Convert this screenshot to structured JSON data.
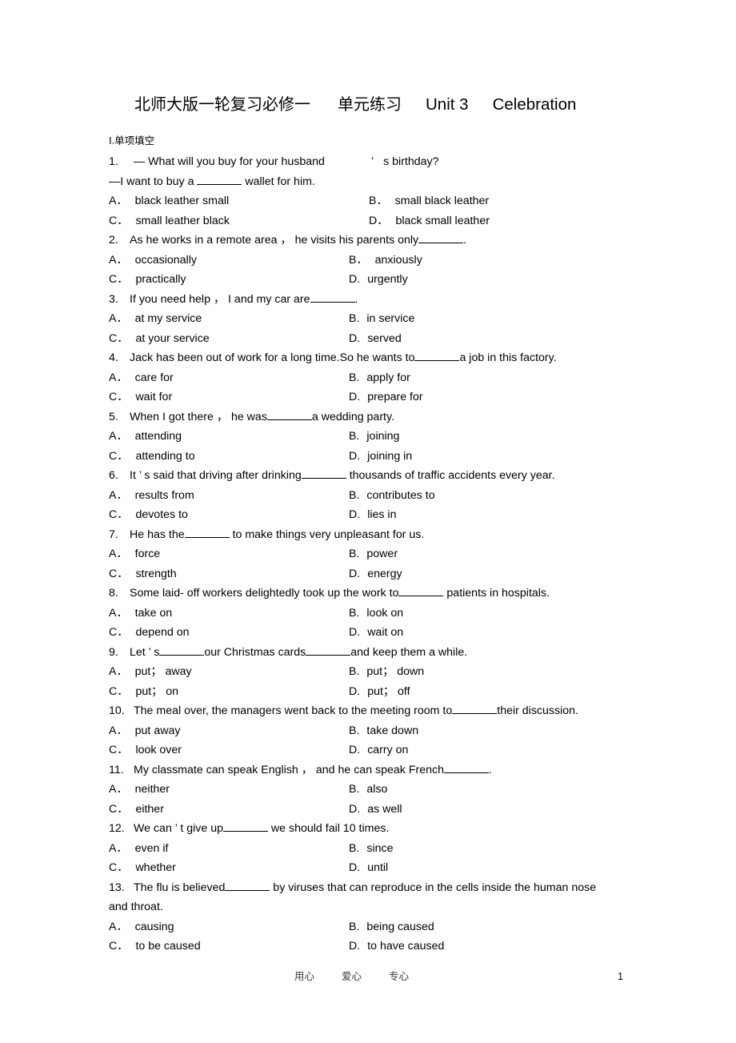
{
  "title": {
    "chinese_main": "北师大版一轮复习必修一",
    "chinese_sub": "单元练习",
    "unit": "Unit 3",
    "topic": "Celebration"
  },
  "section": {
    "roman": "Ⅰ",
    "dot": ".",
    "label": "单项填空"
  },
  "questions": [
    {
      "num": "1.",
      "stem_part1": "— What will you buy for your husband",
      "stem_apostrophe": "’",
      "stem_part2": "s birthday?",
      "stem_line2_pre": "—I want to buy a ",
      "stem_line2_post": " wallet for him.",
      "options": {
        "A": "black leather small",
        "B": "small black leather",
        "C": "small leather black",
        "D": "black small leather"
      }
    },
    {
      "num": "2.",
      "stem_pre": "As he works in a remote area ，  he visits his parents only",
      "stem_post": ".",
      "options": {
        "A": "occasionally",
        "B": "anxiously",
        "C": "practically",
        "D": "urgently"
      }
    },
    {
      "num": "3.",
      "stem_pre": "If you need help ，  I and my car are",
      "stem_post": ".",
      "options": {
        "A": "at my service",
        "B": "in service",
        "C": "at your service",
        "D": "served"
      }
    },
    {
      "num": "4.",
      "stem_pre": "Jack has been out of work for a long time.So he wants to",
      "stem_post": "a job in this factory.",
      "options": {
        "A": "care for",
        "B": "apply for",
        "C": "wait for",
        "D": "prepare for"
      }
    },
    {
      "num": "5.",
      "stem_pre": "When I got there ，  he was",
      "stem_post": "a wedding party.",
      "options": {
        "A": "attending",
        "B": "joining",
        "C": "attending to",
        "D": "joining in"
      }
    },
    {
      "num": "6.",
      "stem_pre": "It ’  s said that driving after drinking",
      "stem_post": " thousands of traffic accidents every year.",
      "options": {
        "A": "results from",
        "B": "contributes to",
        "C": "devotes to",
        "D": "lies in"
      }
    },
    {
      "num": "7.",
      "stem_pre": "He has the",
      "stem_post": " to make things very unpleasant for us.",
      "options": {
        "A": "force",
        "B": "power",
        "C": "strength",
        "D": "energy"
      }
    },
    {
      "num": "8.",
      "stem_pre": "Some laid- off workers delightedly took up the work to",
      "stem_post": " patients in hospitals.",
      "options": {
        "A": "take on",
        "B": "look on",
        "C": "depend on",
        "D": "wait on"
      }
    },
    {
      "num": "9.",
      "stem_pre": "Let ’  s",
      "stem_mid": "our Christmas cards",
      "stem_post": "and keep them a while.",
      "options": {
        "A": "put；  away",
        "B": "put；  down",
        "C": "put；  on",
        "D": "put；  off"
      }
    },
    {
      "num": "10.",
      "stem_pre": "The meal over, the managers went back to the meeting room to",
      "stem_post": "their discussion.",
      "options": {
        "A": "put away",
        "B": "take down",
        "C": "look over",
        "D": "carry on"
      }
    },
    {
      "num": "11.",
      "stem_pre": "My classmate can speak English ，  and he can speak French",
      "stem_post": ".",
      "options": {
        "A": "neither",
        "B": "also",
        "C": "either",
        "D": "as well"
      }
    },
    {
      "num": "12.",
      "stem_pre": "We can ’  t give up",
      "stem_post": " we should fail 10 times.",
      "options": {
        "A": "even if",
        "B": "since",
        "C": "whether",
        "D": "until"
      }
    },
    {
      "num": "13.",
      "stem_pre": "The flu is believed",
      "stem_post": " by viruses that can reproduce in the cells inside the human nose",
      "stem_line2": "and throat.",
      "options": {
        "A": "causing",
        "B": "being caused",
        "C": "to be caused",
        "D": "to have caused"
      }
    }
  ],
  "labels": {
    "A": "A．",
    "B_dotted": "B．",
    "B_plain": "B.",
    "C": "C．",
    "D_dotted": "D．",
    "D_plain": "D."
  },
  "footer": {
    "word1": "用心",
    "word2": "爱心",
    "word3": "专心",
    "page_number": "1"
  }
}
